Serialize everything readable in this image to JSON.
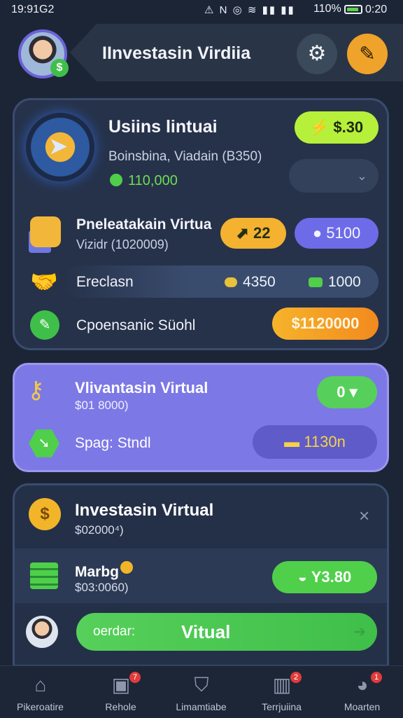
{
  "status_bar": {
    "time_left": "19:91G2",
    "icons": "⚠ N ◎ ≋ ▮▮ ▮▮",
    "battery": "110%",
    "time_right": "0:20"
  },
  "header": {
    "title": "IInvestasin Virdiia",
    "avatar_badge": "$",
    "settings_icon": "gear-icon",
    "edit_icon": "edit-icon"
  },
  "card1": {
    "title": "Usiins lintuai",
    "subtitle": "Boinsbina, Viadain (B350)",
    "balance": "110,000",
    "top_pill": "$.30",
    "top_pill_icon": "⚡",
    "dropdown_icon": "⌄",
    "row1": {
      "title": "Pnelеatakain Virtua",
      "sub": "Vizidr (1020009)",
      "pill_orange": "22",
      "pill_purple": "5100"
    },
    "row2": {
      "title": "Ereclasn",
      "value1": "4350",
      "value2": "1000"
    },
    "row3": {
      "title": "Cpoensanic Süohl",
      "pill": "$1120000"
    }
  },
  "card2": {
    "title": "Vlivantasin Virtual",
    "sub": "$01 8000)",
    "pill": "0 ▾",
    "row_title": "Spag: Stndl",
    "row_pill": "1130n"
  },
  "card3": {
    "title": "Investasin Virtual",
    "sub": "$02000⁴)",
    "close": "×",
    "row_title": "Marbg",
    "row_sub": "$03:0060)",
    "row_pill": "Y3.80",
    "cta_label": "oerdar:",
    "cta_main": "Vitual",
    "cta_arrow": "➔"
  },
  "nav": [
    {
      "label": "Pikeroatire",
      "icon": "home-icon",
      "glyph": "⌂",
      "badge": ""
    },
    {
      "label": "Rehole",
      "icon": "bag-icon",
      "glyph": "▣",
      "badge": "7"
    },
    {
      "label": "Limamtiabe",
      "icon": "shield-icon",
      "glyph": "⛉",
      "badge": ""
    },
    {
      "label": "Terrjuiina",
      "icon": "book-icon",
      "glyph": "▥",
      "badge": "2"
    },
    {
      "label": "Moarten",
      "icon": "chat-icon",
      "glyph": "◕",
      "badge": "1"
    }
  ],
  "colors": {
    "background": "#1c2536",
    "accent_green": "#4fcf4a",
    "accent_orange": "#f4b230",
    "accent_purple": "#7c78e6"
  }
}
